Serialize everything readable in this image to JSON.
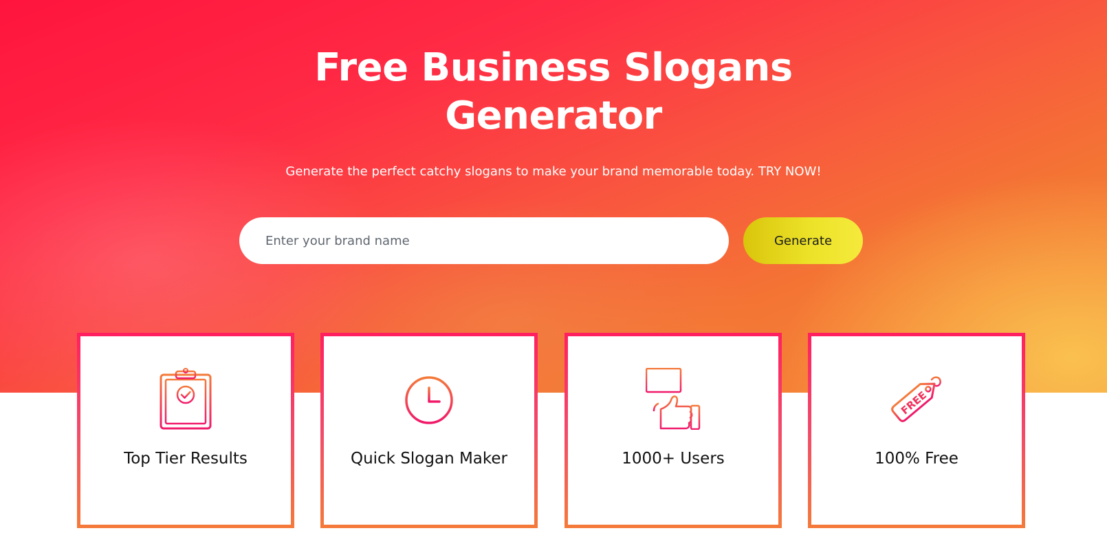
{
  "hero": {
    "title_line1": "Free Business Slogans",
    "title_line2": "Generator",
    "subtitle": "Generate the perfect catchy slogans to make your brand memorable today. TRY NOW!"
  },
  "search": {
    "placeholder": "Enter your brand name",
    "value": ""
  },
  "generate_button": {
    "label": "Generate"
  },
  "features": [
    {
      "label": "Top Tier Results",
      "icon": "clipboard-check-icon"
    },
    {
      "label": "Quick Slogan Maker",
      "icon": "clock-icon"
    },
    {
      "label": "1000+ Users",
      "icon": "thumbs-up-sign-icon"
    },
    {
      "label": "100% Free",
      "icon": "free-tag-icon",
      "icon_text": "FREE"
    }
  ],
  "colors": {
    "hero_gradient_start": "#ff143d",
    "hero_gradient_end": "#f9a23c",
    "button_gradient_start": "#d9c50c",
    "button_gradient_end": "#f5ea3c",
    "card_border_top": "#ff1f60",
    "card_border_bottom": "#f47a3a"
  }
}
